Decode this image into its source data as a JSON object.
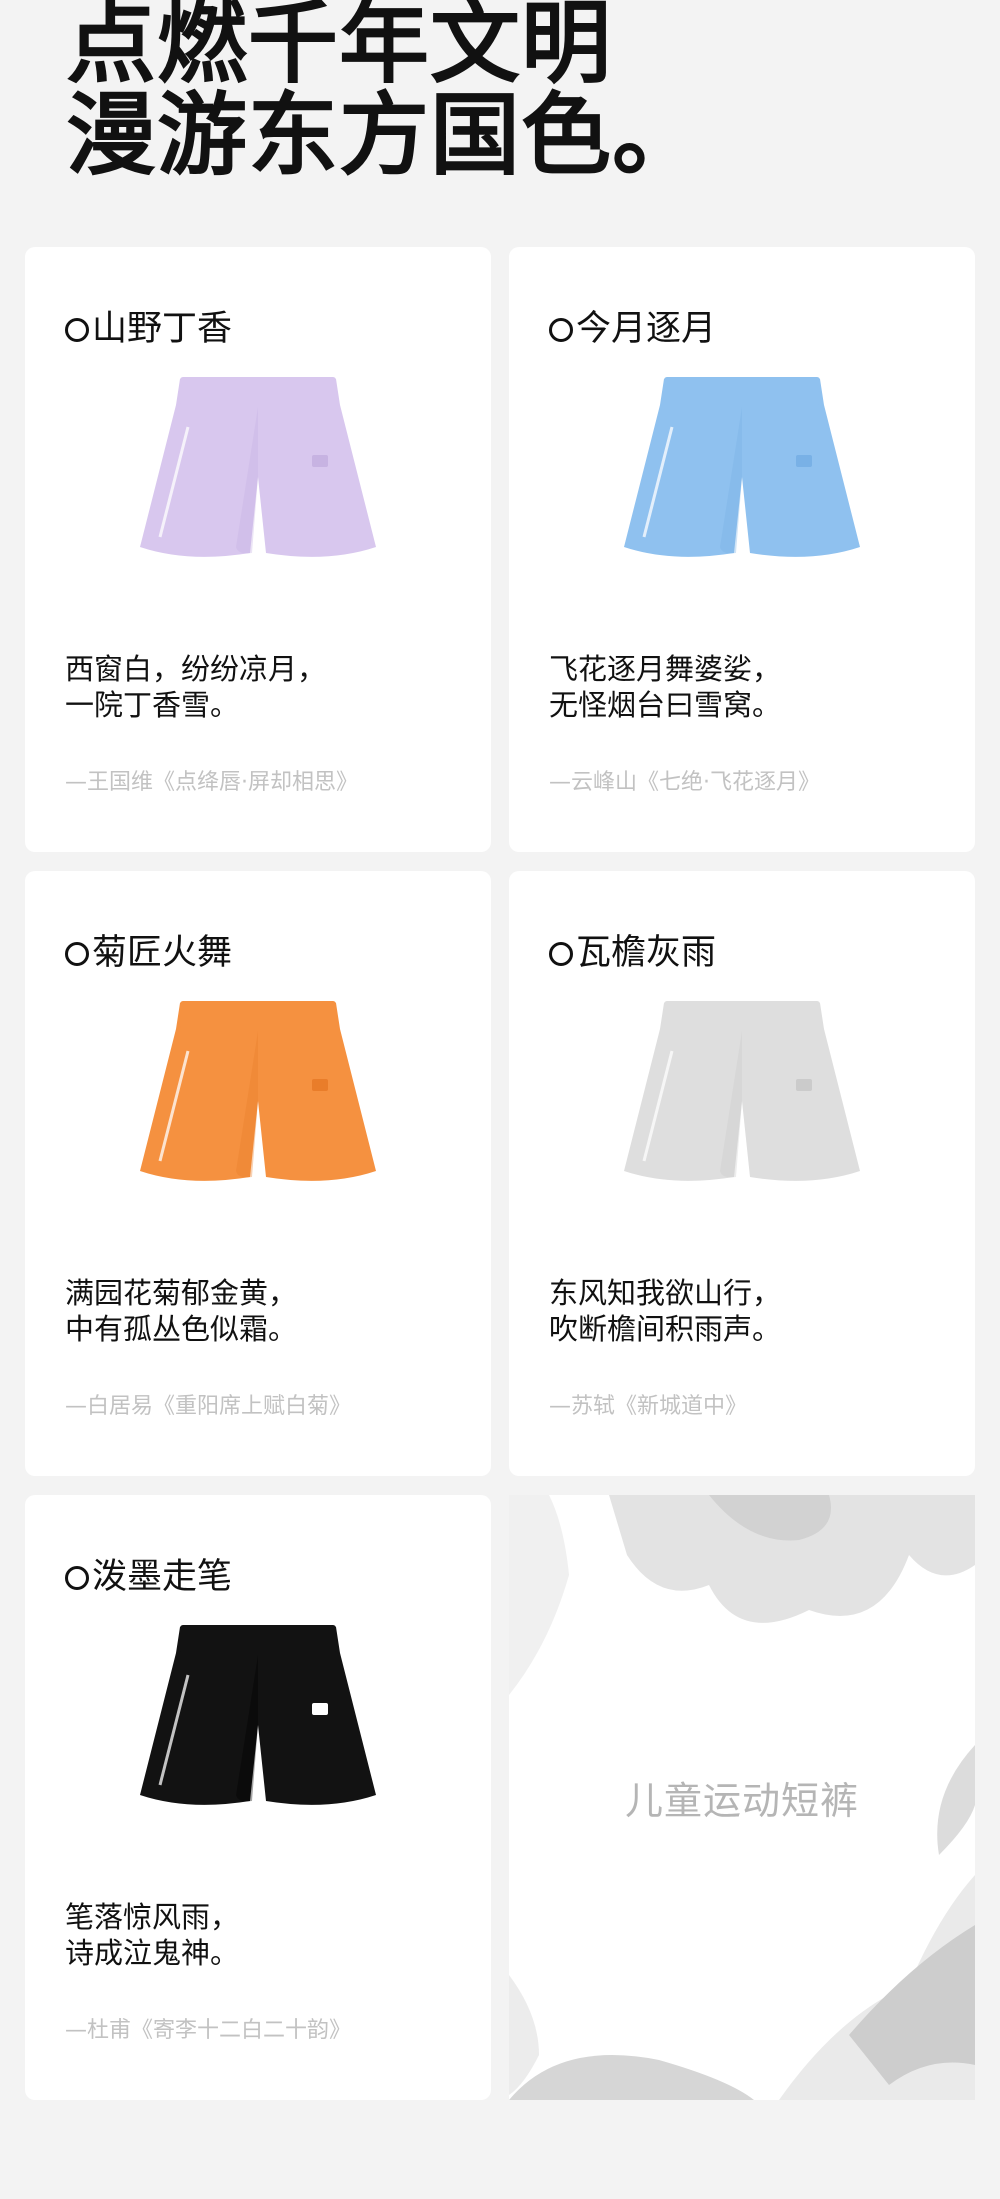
{
  "headline": {
    "line1": "点燃千年文明",
    "line2": "漫游东方国色。"
  },
  "products": [
    {
      "name": "山野丁香",
      "color": "#d8c7ee",
      "shade": "#c7b3e2",
      "poem_line1": "西窗白，纷纷凉月，",
      "poem_line2": "一院丁香雪。",
      "source": "—王国维《点绛唇·屏却相思》"
    },
    {
      "name": "今月逐月",
      "color": "#8fc1ef",
      "shade": "#79b1e6",
      "poem_line1": "飞花逐月舞婆娑，",
      "poem_line2": "无怪烟台曰雪窝。",
      "source": "—云峰山《七绝·飞花逐月》"
    },
    {
      "name": "菊匠火舞",
      "color": "#f59140",
      "shade": "#e97d2a",
      "poem_line1": "满园花菊郁金黄，",
      "poem_line2": "中有孤丛色似霜。",
      "source": "—白居易《重阳席上赋白菊》"
    },
    {
      "name": "瓦檐灰雨",
      "color": "#dedede",
      "shade": "#cbcbcb",
      "poem_line1": "东风知我欲山行，",
      "poem_line2": "吹断檐间积雨声。",
      "source": "—苏轼《新城道中》"
    },
    {
      "name": "泼墨走笔",
      "color": "#121212",
      "shade": "#000000",
      "poem_line1": "笔落惊风雨，",
      "poem_line2": "诗成泣鬼神。",
      "source": "—杜甫《寄李十二白二十韵》"
    }
  ],
  "promo": {
    "label": "儿童运动短裤"
  }
}
